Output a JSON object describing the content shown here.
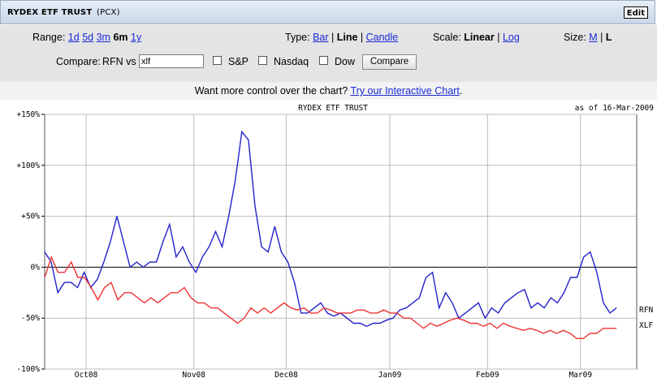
{
  "header": {
    "title": "RYDEX ETF TRUST",
    "exchange": "(PCX)",
    "edit_label": "Edit"
  },
  "controls": {
    "range": {
      "label": "Range:",
      "options": [
        "1d",
        "5d",
        "3m",
        "6m",
        "1y"
      ],
      "selected": "6m"
    },
    "type": {
      "label": "Type:",
      "options": [
        "Bar",
        "Line",
        "Candle"
      ],
      "selected": "Line"
    },
    "scale": {
      "label": "Scale:",
      "options": [
        "Linear",
        "Log"
      ],
      "selected": "Linear"
    },
    "size": {
      "label": "Size:",
      "options": [
        "M",
        "L"
      ],
      "selected": "L"
    },
    "compare": {
      "label": "Compare:",
      "prefix": "RFN vs",
      "value": "xlf",
      "checkboxes": [
        "S&P",
        "Nasdaq",
        "Dow"
      ],
      "button": "Compare"
    }
  },
  "promo": {
    "text": "Want more control over the chart?",
    "link": "Try our Interactive Chart",
    "suffix": "."
  },
  "chart_data": {
    "type": "line",
    "title": "RYDEX ETF TRUST",
    "date_label": "as of 16-Mar-2009",
    "ylim": [
      -100,
      150
    ],
    "yticks": [
      "+150%",
      "+100%",
      "+50%",
      "0%",
      "-50%",
      "-100%"
    ],
    "xticks": [
      "Oct08",
      "Nov08",
      "Dec08",
      "Jan09",
      "Feb09",
      "Mar09"
    ],
    "grid": true,
    "series": [
      {
        "name": "RFN",
        "color": "#2222cc",
        "values": [
          15,
          5,
          -25,
          -15,
          -15,
          -20,
          -5,
          -20,
          -12,
          5,
          25,
          50,
          25,
          0,
          5,
          0,
          5,
          5,
          25,
          42,
          10,
          20,
          5,
          -5,
          10,
          20,
          35,
          20,
          50,
          85,
          133,
          125,
          60,
          20,
          15,
          40,
          15,
          5,
          -15,
          -45,
          -45,
          -40,
          -35,
          -45,
          -48,
          -45,
          -50,
          -55,
          -55,
          -58,
          -55,
          -55,
          -52,
          -50,
          -42,
          -40,
          -35,
          -30,
          -10,
          -5,
          -40,
          -25,
          -35,
          -50,
          -45,
          -40,
          -35,
          -50,
          -40,
          -45,
          -35,
          -30,
          -25,
          -22,
          -40,
          -35,
          -40,
          -30,
          -35,
          -25,
          -10,
          -10,
          10,
          15,
          -5,
          -35,
          -45,
          -40
        ]
      },
      {
        "name": "XLF",
        "color": "#ee3333",
        "values": [
          -10,
          10,
          -5,
          -5,
          5,
          -10,
          -10,
          -20,
          -32,
          -20,
          -15,
          -32,
          -25,
          -25,
          -30,
          -35,
          -30,
          -35,
          -30,
          -25,
          -25,
          -20,
          -30,
          -35,
          -35,
          -40,
          -40,
          -45,
          -50,
          -55,
          -50,
          -40,
          -45,
          -40,
          -45,
          -40,
          -35,
          -40,
          -42,
          -40,
          -45,
          -45,
          -40,
          -42,
          -45,
          -45,
          -45,
          -42,
          -42,
          -45,
          -45,
          -42,
          -45,
          -45,
          -50,
          -50,
          -55,
          -60,
          -55,
          -58,
          -55,
          -52,
          -50,
          -52,
          -55,
          -55,
          -58,
          -55,
          -60,
          -55,
          -58,
          -60,
          -62,
          -60,
          -62,
          -65,
          -62,
          -65,
          -62,
          -65,
          -70,
          -70,
          -65,
          -65,
          -60,
          -60,
          -60
        ]
      }
    ]
  }
}
